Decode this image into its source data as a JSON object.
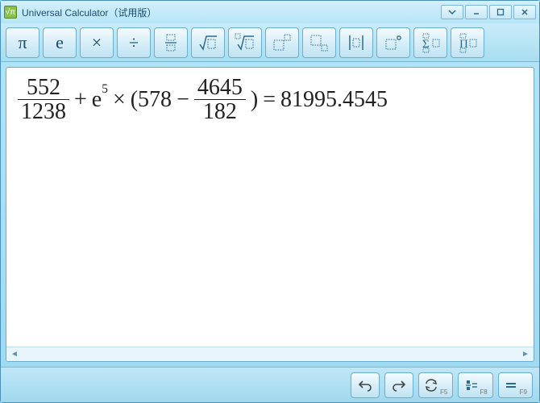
{
  "window": {
    "title": "Universal Calculator（试用版）"
  },
  "toolbar": {
    "pi": "π",
    "e": "e",
    "times": "×",
    "divide": "÷"
  },
  "expression": {
    "frac1_num": "552",
    "frac1_den": "1238",
    "plus": "+",
    "e": "e",
    "exp": "5",
    "times": "×",
    "lparen": "(578",
    "minus": "−",
    "frac2_num": "4645",
    "frac2_den": "182",
    "rparen": ")",
    "equals": "=",
    "result": "81995.4545"
  },
  "bottombar": {
    "f5": "F5",
    "f8": "F8",
    "f9": "F9"
  }
}
